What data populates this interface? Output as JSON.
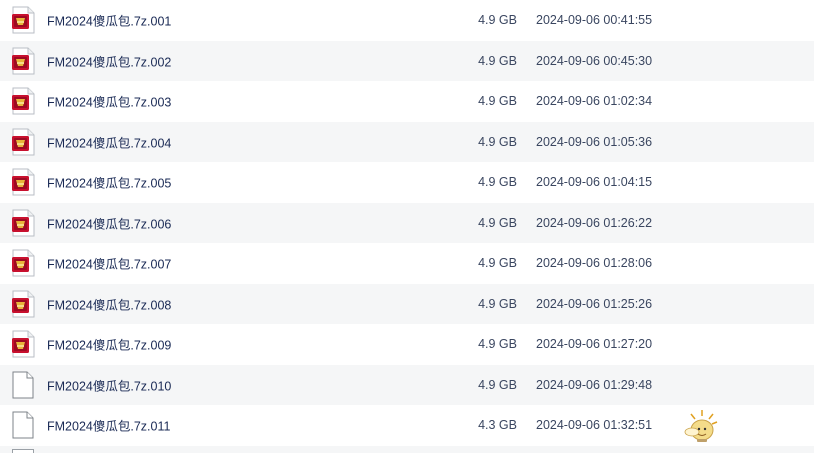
{
  "files": [
    {
      "name": "FM2024傻瓜包.7z.001",
      "size": "4.9 GB",
      "date": "2024-09-06 00:41:55",
      "icon": "archive-icon"
    },
    {
      "name": "FM2024傻瓜包.7z.002",
      "size": "4.9 GB",
      "date": "2024-09-06 00:45:30",
      "icon": "archive-icon"
    },
    {
      "name": "FM2024傻瓜包.7z.003",
      "size": "4.9 GB",
      "date": "2024-09-06 01:02:34",
      "icon": "archive-icon"
    },
    {
      "name": "FM2024傻瓜包.7z.004",
      "size": "4.9 GB",
      "date": "2024-09-06 01:05:36",
      "icon": "archive-icon"
    },
    {
      "name": "FM2024傻瓜包.7z.005",
      "size": "4.9 GB",
      "date": "2024-09-06 01:04:15",
      "icon": "archive-icon"
    },
    {
      "name": "FM2024傻瓜包.7z.006",
      "size": "4.9 GB",
      "date": "2024-09-06 01:26:22",
      "icon": "archive-icon"
    },
    {
      "name": "FM2024傻瓜包.7z.007",
      "size": "4.9 GB",
      "date": "2024-09-06 01:28:06",
      "icon": "archive-icon"
    },
    {
      "name": "FM2024傻瓜包.7z.008",
      "size": "4.9 GB",
      "date": "2024-09-06 01:25:26",
      "icon": "archive-icon"
    },
    {
      "name": "FM2024傻瓜包.7z.009",
      "size": "4.9 GB",
      "date": "2024-09-06 01:27:20",
      "icon": "archive-icon"
    },
    {
      "name": "FM2024傻瓜包.7z.010",
      "size": "4.9 GB",
      "date": "2024-09-06 01:29:48",
      "icon": "blank-file-icon"
    },
    {
      "name": "FM2024傻瓜包.7z.011",
      "size": "4.3 GB",
      "date": "2024-09-06 01:32:51",
      "icon": "blank-file-icon"
    }
  ],
  "colors": {
    "row_alt": "#f5f6f7",
    "name_text": "#1a2a55",
    "meta_text": "#3a4660",
    "archive_red": "#c8102e",
    "archive_gold": "#e8b53a"
  },
  "mascot_icon": "bulb-mascot-icon"
}
